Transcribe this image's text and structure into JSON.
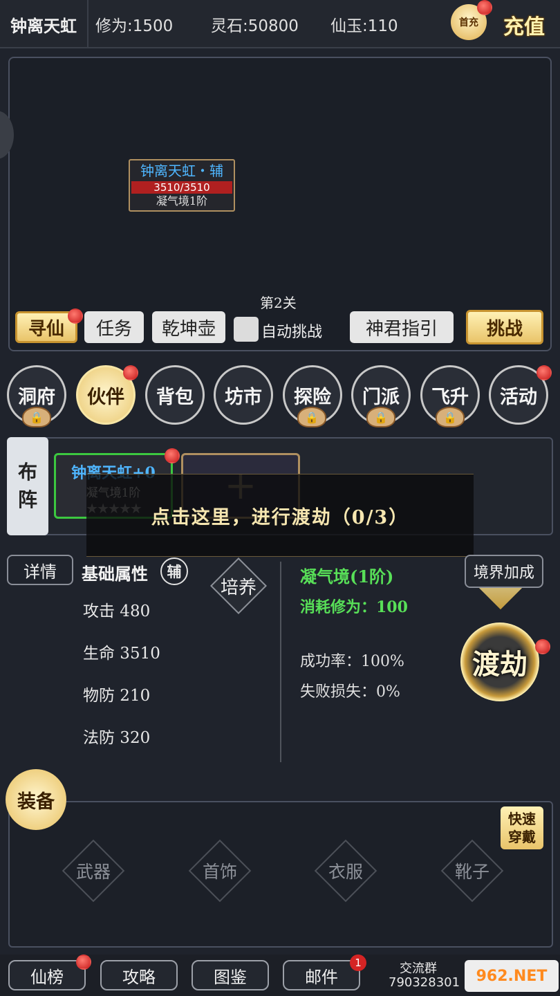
{
  "header": {
    "player_name": "钟离天虹",
    "cultivation": "修为:1500",
    "spirit_stones": "灵石:50800",
    "jade": "仙玉:110",
    "gift_label": "首充",
    "recharge": "充值"
  },
  "battle": {
    "enemy_name": "钟离天虹・辅",
    "enemy_hp": "3510/3510",
    "enemy_realm": "凝气境1阶",
    "stage": "第2关"
  },
  "actions": {
    "seek_immortal": "寻仙",
    "tasks": "任务",
    "qiankun_pot": "乾坤壶",
    "auto_challenge": "自动挑战",
    "guide": "神君指引",
    "challenge": "挑战"
  },
  "nav": [
    {
      "label": "洞府",
      "locked": true
    },
    {
      "label": "伙伴",
      "active": true
    },
    {
      "label": "背包"
    },
    {
      "label": "坊市"
    },
    {
      "label": "探险",
      "locked": true
    },
    {
      "label": "门派",
      "locked": true
    },
    {
      "label": "飞升",
      "locked": true
    },
    {
      "label": "活动"
    }
  ],
  "formation": {
    "tab": [
      "布",
      "阵"
    ],
    "hero_name": "钟离天虹+0",
    "hero_realm": "凝气境1阶",
    "stars": "★★★★★",
    "empty_slot": "+"
  },
  "tutorial": {
    "text": "点击这里，进行渡劫（0/3）"
  },
  "details": {
    "detail_btn": "详情",
    "attr_title": "基础属性",
    "role_badge": "辅",
    "train": "培养",
    "attrs": [
      "攻击 480",
      "生命 3510",
      "物防 210",
      "法防 320"
    ]
  },
  "tribulation": {
    "realm": "凝气境(1阶)",
    "cost": "消耗修为：100",
    "success": "成功率：100%",
    "loss": "失败损失：0%",
    "realm_bonus": "境界加成",
    "button": "渡劫"
  },
  "equipment": {
    "badge": "装备",
    "quick": [
      "快速",
      "穿戴"
    ],
    "slots": [
      "武器",
      "首饰",
      "衣服",
      "靴子"
    ]
  },
  "bottom": {
    "ranking": "仙榜",
    "strategy": "攻略",
    "codex": "图鉴",
    "mail": "邮件",
    "mail_count": "1",
    "group_label": "交流群",
    "group_number": "790328301",
    "watermark": "962.NET"
  }
}
